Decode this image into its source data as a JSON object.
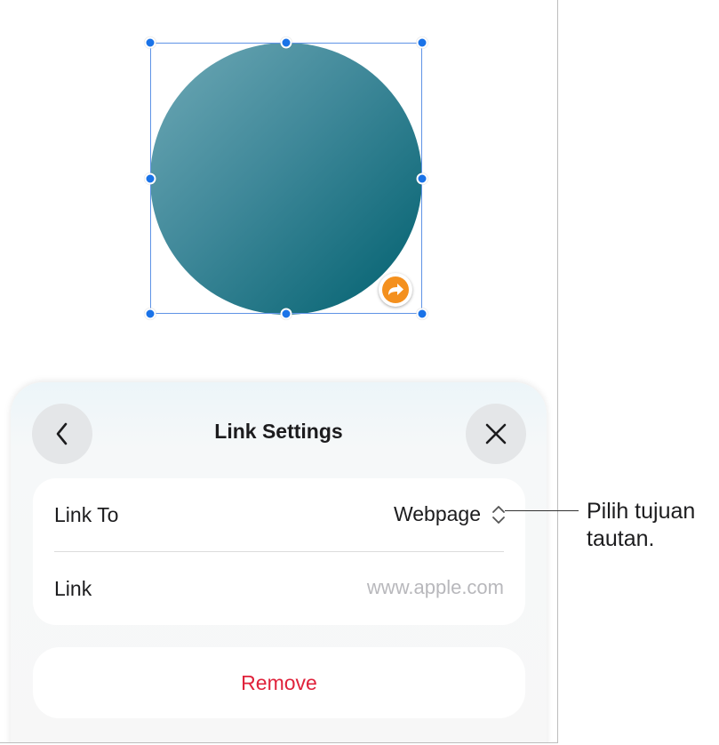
{
  "sheet": {
    "title": "Link Settings",
    "back_icon": "chevron-left-icon",
    "close_icon": "close-icon"
  },
  "link_to": {
    "label": "Link To",
    "value": "Webpage",
    "icon": "chevron-up-down-icon"
  },
  "link": {
    "label": "Link",
    "placeholder": "www.apple.com"
  },
  "remove": {
    "label": "Remove"
  },
  "callout": {
    "line1": "Pilih tujuan",
    "line2": "tautan."
  },
  "colors": {
    "selection_handle": "#1a73e8",
    "link_badge": "#f4901e",
    "remove_text": "#e0223b",
    "shape_gradient_start": "#6fa9b6",
    "shape_gradient_end": "#00606f"
  }
}
